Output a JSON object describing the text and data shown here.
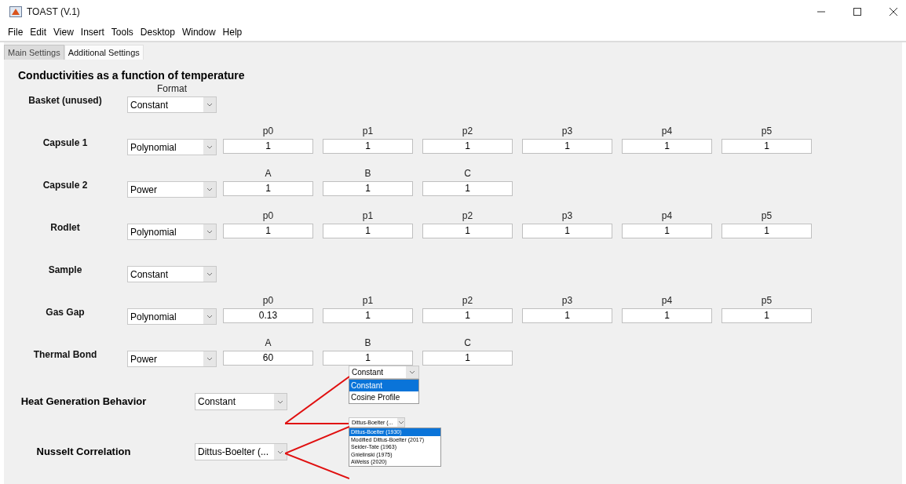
{
  "window": {
    "title": "TOAST (V.1)"
  },
  "menu": [
    "File",
    "Edit",
    "View",
    "Insert",
    "Tools",
    "Desktop",
    "Window",
    "Help"
  ],
  "tabs": [
    {
      "label": "Main Settings",
      "selected": false
    },
    {
      "label": "Additional Settings",
      "selected": true
    }
  ],
  "section_title": "Conductivities as a function of temperature",
  "format_header": "Format",
  "materials": [
    {
      "label": "Basket (unused)",
      "format": "Constant"
    },
    {
      "label": "Capsule 1",
      "format": "Polynomial",
      "params": [
        {
          "header": "p0",
          "value": "1"
        },
        {
          "header": "p1",
          "value": "1"
        },
        {
          "header": "p2",
          "value": "1"
        },
        {
          "header": "p3",
          "value": "1"
        },
        {
          "header": "p4",
          "value": "1"
        },
        {
          "header": "p5",
          "value": "1"
        }
      ]
    },
    {
      "label": "Capsule 2",
      "format": "Power",
      "params": [
        {
          "header": "A",
          "value": "1"
        },
        {
          "header": "B",
          "value": "1"
        },
        {
          "header": "C",
          "value": "1"
        }
      ]
    },
    {
      "label": "Rodlet",
      "format": "Polynomial",
      "params": [
        {
          "header": "p0",
          "value": "1"
        },
        {
          "header": "p1",
          "value": "1"
        },
        {
          "header": "p2",
          "value": "1"
        },
        {
          "header": "p3",
          "value": "1"
        },
        {
          "header": "p4",
          "value": "1"
        },
        {
          "header": "p5",
          "value": "1"
        }
      ]
    },
    {
      "label": "Sample",
      "format": "Constant"
    },
    {
      "label": "Gas Gap",
      "format": "Polynomial",
      "params": [
        {
          "header": "p0",
          "value": "0.13"
        },
        {
          "header": "p1",
          "value": "1"
        },
        {
          "header": "p2",
          "value": "1"
        },
        {
          "header": "p3",
          "value": "1"
        },
        {
          "header": "p4",
          "value": "1"
        },
        {
          "header": "p5",
          "value": "1"
        }
      ]
    },
    {
      "label": "Thermal Bond",
      "format": "Power",
      "params": [
        {
          "header": "A",
          "value": "60"
        },
        {
          "header": "B",
          "value": "1"
        },
        {
          "header": "C",
          "value": "1"
        }
      ]
    }
  ],
  "behaviors": [
    {
      "label": "Heat Generation Behavior",
      "value": "Constant",
      "preview": {
        "value": "Constant",
        "options": [
          {
            "label": "Constant",
            "selected": true
          },
          {
            "label": "Cosine Profile",
            "selected": false
          }
        ]
      }
    },
    {
      "label": "Nusselt Correlation",
      "value": "Dittus-Boelter (...",
      "preview": {
        "value": "Dittus-Boelter (...",
        "options": [
          {
            "label": "Dittus-Boelter (1930)",
            "selected": true
          },
          {
            "label": "Modified Dittus-Boelter (2017)",
            "selected": false
          },
          {
            "label": "Seider-Tate (1963)",
            "selected": false
          },
          {
            "label": "Gnielinski (1975)",
            "selected": false
          },
          {
            "label": "AWeiss (2020)",
            "selected": false
          }
        ]
      }
    }
  ]
}
